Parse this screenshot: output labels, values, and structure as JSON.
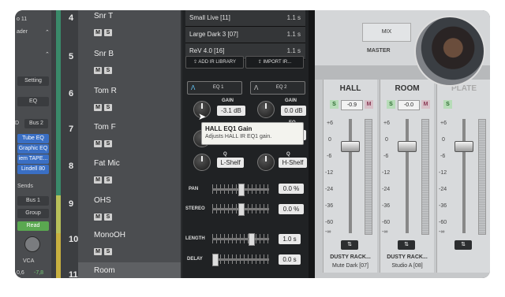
{
  "left_strip": {
    "top_num": "o 11",
    "top_select": "ader",
    "setting": "Setting",
    "eq": "EQ",
    "bus2": "Bus 2",
    "d_label": "D",
    "plugins": [
      "Tube EQ",
      "Graphic EQ",
      "iem TAPE...",
      "Lindell 80"
    ],
    "sends": "Sends",
    "bus1": "Bus 1",
    "group": "Group",
    "read": "Read",
    "vca": "VCA",
    "bottom_vals": [
      "0,6",
      "-7,8"
    ]
  },
  "tracks": [
    {
      "num": "4",
      "name": "Snr T",
      "color": "#3a8a6a"
    },
    {
      "num": "5",
      "name": "Snr B",
      "color": "#3a8a6a"
    },
    {
      "num": "6",
      "name": "Tom R",
      "color": "#3a8a6a"
    },
    {
      "num": "7",
      "name": "Tom F",
      "color": "#3a8a6a"
    },
    {
      "num": "8",
      "name": "Fat Mic",
      "color": "#3a8a6a"
    },
    {
      "num": "9",
      "name": "OHS",
      "color": "#b8c05a"
    },
    {
      "num": "10",
      "name": "MonoOH",
      "color": "#c8b040"
    },
    {
      "num": "11",
      "name": "Room",
      "color": "#c8b040"
    }
  ],
  "ms": {
    "m": "M",
    "s": "S"
  },
  "ir_list": [
    {
      "name": "Small Live [11]",
      "len": "1.1 s"
    },
    {
      "name": "Large Dark 3 [07]",
      "len": "1.1 s"
    },
    {
      "name": "ReV 4.0 [16]",
      "len": "1.1 s"
    }
  ],
  "ir_buttons": {
    "add": "ADD IR LIBRARY",
    "import": "IMPORT IR..."
  },
  "eq1": {
    "label": "EQ 1",
    "gain_label": "GAIN",
    "gain": "-3.1 dB",
    "q_label": "Q",
    "shape": "L-Shelf"
  },
  "eq2": {
    "label": "EQ 2",
    "gain_label": "GAIN",
    "gain": "0.0 dB",
    "freq_partial": "kHz",
    "eq_partial": "EQ",
    "q_label": "Q",
    "shape": "H-Shelf"
  },
  "tooltip": {
    "title": "HALL EQ1 Gain",
    "desc": "Adjusts HALL IR EQ1 gain."
  },
  "sliders": {
    "pan": {
      "label": "PAN",
      "value": "0.0 %"
    },
    "stereo": {
      "label": "STEREO",
      "value": "0.0 %"
    },
    "length": {
      "label": "LENGTH",
      "value": "1.0 s"
    },
    "delay": {
      "label": "DELAY",
      "value": "0.0 s"
    }
  },
  "mixer": {
    "mix_label": "MIX",
    "master_label": "MASTER",
    "scale": [
      "+6",
      "0",
      "-6",
      "-12",
      "-24",
      "-36",
      "-60",
      "-∞"
    ],
    "channels": [
      {
        "name": "HALL",
        "pan": "-0.9",
        "footer1": "DUSTY RACK...",
        "footer2": "Mute Dark [07]"
      },
      {
        "name": "ROOM",
        "pan": "-0.0",
        "footer1": "DUSTY RACK...",
        "footer2": "Studio A [08]"
      },
      {
        "name": "PLATE",
        "pan": "",
        "footer1": "",
        "footer2": ""
      }
    ],
    "s": "S",
    "m": "M"
  }
}
